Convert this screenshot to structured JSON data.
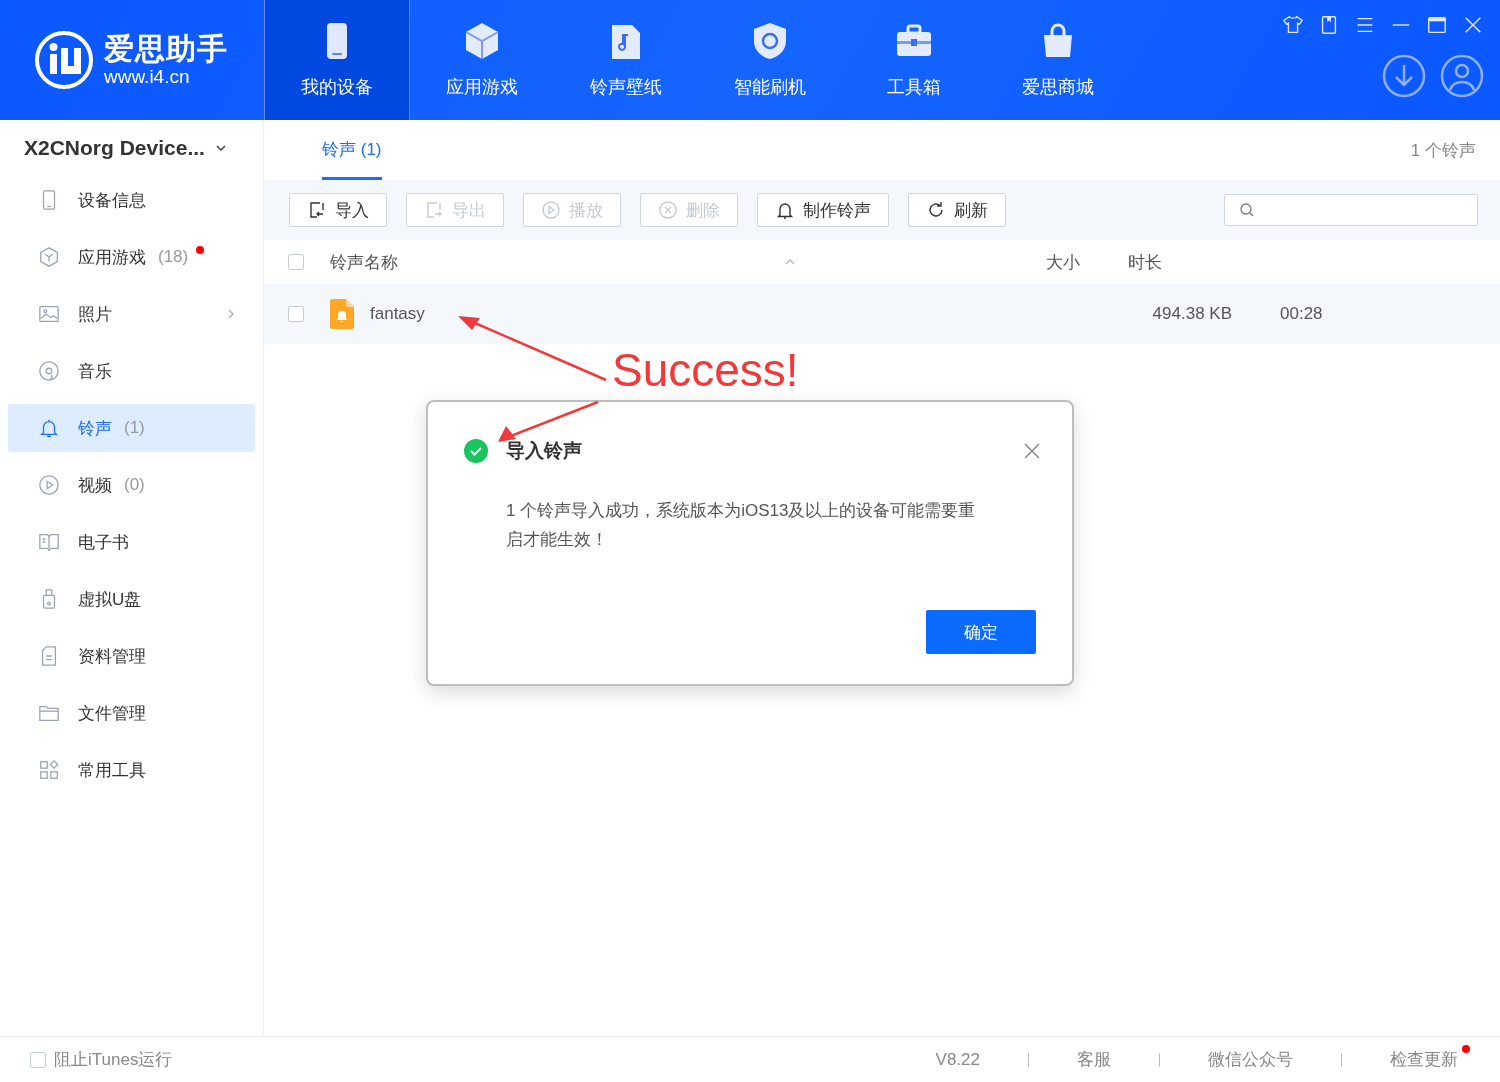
{
  "app": {
    "logo_name": "爱思助手",
    "logo_url": "www.i4.cn"
  },
  "nav_tabs": [
    {
      "label": "我的设备",
      "selected": true
    },
    {
      "label": "应用游戏",
      "selected": false
    },
    {
      "label": "铃声壁纸",
      "selected": false
    },
    {
      "label": "智能刷机",
      "selected": false
    },
    {
      "label": "工具箱",
      "selected": false
    },
    {
      "label": "爱思商城",
      "selected": false
    }
  ],
  "sidebar": {
    "device": "X2CNorg Device...",
    "items": [
      {
        "label": "设备信息",
        "selected": false
      },
      {
        "label": "应用游戏",
        "count": "(18)",
        "dot": true,
        "selected": false
      },
      {
        "label": "照片",
        "chevron": true,
        "selected": false
      },
      {
        "label": "音乐",
        "selected": false
      },
      {
        "label": "铃声",
        "count": "(1)",
        "selected": true
      },
      {
        "label": "视频",
        "count": "(0)",
        "selected": false
      },
      {
        "label": "电子书",
        "selected": false
      },
      {
        "label": "虚拟U盘",
        "selected": false
      },
      {
        "label": "资料管理",
        "selected": false
      },
      {
        "label": "文件管理",
        "selected": false
      },
      {
        "label": "常用工具",
        "selected": false
      }
    ]
  },
  "content_tabs": [
    {
      "label": "铃声 (1)",
      "selected": true
    }
  ],
  "summary": "1 个铃声",
  "toolbar": [
    {
      "label": "导入",
      "disabled": false
    },
    {
      "label": "导出",
      "disabled": true
    },
    {
      "label": "播放",
      "disabled": true
    },
    {
      "label": "删除",
      "disabled": true
    },
    {
      "label": "制作铃声",
      "disabled": false
    },
    {
      "label": "刷新",
      "disabled": false
    }
  ],
  "table": {
    "select_all_checked": false,
    "columns": [
      "铃声名称",
      "大小",
      "时长"
    ],
    "rows": [
      {
        "name": "fantasy",
        "size": "494.38 KB",
        "duration": "00:28",
        "checked": false
      }
    ]
  },
  "annotation": "Success!",
  "dialog": {
    "title": "导入铃声",
    "message": "1 个铃声导入成功，系统版本为iOS13及以上的设备可能需要重启才能生效！",
    "button": "确定"
  },
  "footer": {
    "checkbox": {
      "label": "阻止iTunes运行",
      "checked": false
    },
    "version": "V8.22",
    "links": [
      {
        "label": "客服",
        "dot": false
      },
      {
        "label": "微信公众号",
        "dot": false
      },
      {
        "label": "检查更新",
        "dot": true
      }
    ]
  }
}
